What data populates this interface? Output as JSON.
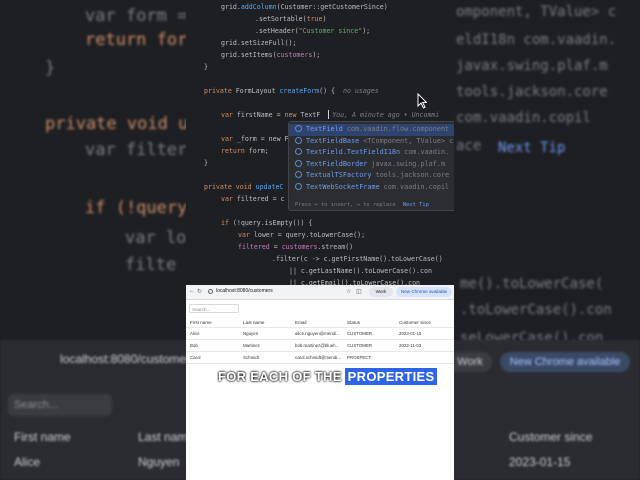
{
  "background": {
    "code_lines": [
      {
        "text": "var form = ...",
        "cls": ""
      },
      {
        "text": "return for",
        "cls": "kw"
      },
      {
        "text": "}",
        "cls": ""
      },
      {
        "text": "private void u",
        "cls": "kw"
      },
      {
        "text": "var filter",
        "cls": ""
      },
      {
        "text": "if (!query",
        "cls": "kw"
      },
      {
        "text": "var lo",
        "cls": ""
      },
      {
        "text": "filte",
        "cls": ""
      }
    ],
    "right_fragments": [
      "omponent, TValue> c",
      "eldI18n com.vaadin.",
      "javax.swing.plaf.m",
      "tools.jackson.core",
      "com.vaadin.copil",
      "ace",
      "Next Tip",
      "me().toLowerCase(",
      ".toLowerCase().con",
      "seLowerCase().con"
    ],
    "url": "localhost:8080/customers",
    "chip_work": "Work",
    "chip_chrome": "New Chrome available",
    "search_placeholder": "Search...",
    "headers": [
      "First name",
      "Last name",
      "Customer since"
    ],
    "row": [
      "Alice",
      "Nguyen",
      "2023-01-15"
    ]
  },
  "editor": {
    "lines": [
      {
        "indent": 1,
        "html_parts": [
          [
            "grid.",
            ""
          ],
          [
            "addColumn",
            "m"
          ],
          [
            "(Customer::getCustomerSince)",
            ""
          ]
        ]
      },
      {
        "indent": 3,
        "html_parts": [
          [
            ".setSortable(",
            ""
          ],
          [
            "true",
            "k"
          ],
          [
            ")",
            ""
          ]
        ]
      },
      {
        "indent": 3,
        "html_parts": [
          [
            ".setHeader(",
            ""
          ],
          [
            "\"Customer since\"",
            "s"
          ],
          [
            ");",
            ""
          ]
        ]
      },
      {
        "indent": 1,
        "html_parts": [
          [
            "grid.setSizeFull();",
            ""
          ]
        ]
      },
      {
        "indent": 1,
        "html_parts": [
          [
            "grid.setItems(",
            ""
          ],
          [
            "customers",
            "f"
          ],
          [
            ");",
            ""
          ]
        ]
      },
      {
        "indent": 0,
        "html_parts": [
          [
            "}",
            ""
          ]
        ]
      },
      {
        "indent": 0,
        "html_parts": [
          [
            "",
            ""
          ]
        ]
      },
      {
        "indent": 0,
        "html_parts": [
          [
            "private ",
            "k"
          ],
          [
            "FormLayout ",
            ""
          ],
          [
            "createForm",
            "m"
          ],
          [
            "() {  ",
            ""
          ],
          [
            "no usages",
            "g"
          ]
        ]
      },
      {
        "indent": 0,
        "html_parts": [
          [
            "",
            ""
          ]
        ]
      },
      {
        "indent": 1,
        "html_parts": [
          [
            "var ",
            "k"
          ],
          [
            "firstName = ",
            ""
          ],
          [
            "new ",
            "k"
          ],
          [
            "TextF",
            ""
          ],
          [
            "   You, A minute ago • Uncommi",
            "g"
          ]
        ]
      },
      {
        "indent": 0,
        "html_parts": [
          [
            "",
            ""
          ]
        ]
      },
      {
        "indent": 1,
        "html_parts": [
          [
            "var ",
            "k"
          ],
          [
            "_form = new F",
            ""
          ]
        ]
      },
      {
        "indent": 1,
        "html_parts": [
          [
            "return ",
            "k"
          ],
          [
            "form;",
            ""
          ]
        ]
      },
      {
        "indent": 0,
        "html_parts": [
          [
            "}",
            ""
          ]
        ]
      },
      {
        "indent": 0,
        "html_parts": [
          [
            "",
            ""
          ]
        ]
      },
      {
        "indent": 0,
        "html_parts": [
          [
            "private void ",
            "k"
          ],
          [
            "updateC",
            "m"
          ]
        ]
      },
      {
        "indent": 1,
        "html_parts": [
          [
            "var ",
            "k"
          ],
          [
            "filtered = c",
            ""
          ]
        ]
      },
      {
        "indent": 0,
        "html_parts": [
          [
            "",
            ""
          ]
        ]
      },
      {
        "indent": 1,
        "html_parts": [
          [
            "if ",
            "k"
          ],
          [
            "(!query.isEmpty()) {",
            ""
          ]
        ]
      },
      {
        "indent": 2,
        "html_parts": [
          [
            "var ",
            "k"
          ],
          [
            "lower = query.toLowerCase();",
            ""
          ]
        ]
      },
      {
        "indent": 2,
        "html_parts": [
          [
            "filtered",
            "f"
          ],
          [
            " = ",
            ""
          ],
          [
            "customers",
            "f"
          ],
          [
            ".stream()",
            ""
          ]
        ]
      },
      {
        "indent": 4,
        "html_parts": [
          [
            ".filter(c -> c.getFirstName().toLowerCase()",
            ""
          ]
        ]
      },
      {
        "indent": 5,
        "html_parts": [
          [
            "|| c.getLastName().toLowerCase().con",
            ""
          ]
        ]
      },
      {
        "indent": 5,
        "html_parts": [
          [
            "|| c.getEmail().toLowerCase().con",
            ""
          ]
        ]
      }
    ]
  },
  "completion": {
    "items": [
      {
        "name": "TextField",
        "pkg": "com.vaadin.flow.component"
      },
      {
        "name": "TextFieldBase",
        "pkg": "<TComponent, TValue> c"
      },
      {
        "name": "TextField.TextFieldI18n",
        "pkg": "com.vaadin."
      },
      {
        "name": "TextFieldBorder",
        "pkg": "javax.swing.plaf.m"
      },
      {
        "name": "TextualTSFactory",
        "pkg": "tools.jackson.core"
      },
      {
        "name": "TextWebSocketFrame",
        "pkg": "com.vaadin.copil"
      }
    ],
    "footer": "Press ↩ to insert, → to replace",
    "next_tip": "Next Tip"
  },
  "browser": {
    "url": "localhost:8080/customers",
    "work": "Work",
    "chrome_update": "New Chrome available",
    "search_placeholder": "Search...",
    "columns": [
      "First name",
      "Last name",
      "Email",
      "Status",
      "Customer since"
    ],
    "rows": [
      [
        "Alice",
        "Nguyen",
        "alice.nguyen@meridi...",
        "CUSTOMER",
        "2023-01-15"
      ],
      [
        "Bob",
        "Martinez",
        "bob.martinez@blueh...",
        "CUSTOMER",
        "2022-11-03"
      ],
      [
        "Carol",
        "Schmidt",
        "carol.schmidt@meridi...",
        "PROSPECT",
        ""
      ]
    ]
  },
  "caption": {
    "plain": "FOR EACH OF THE",
    "highlight": "PROPERTIES",
    "highlight_color": "#2f63e8"
  }
}
